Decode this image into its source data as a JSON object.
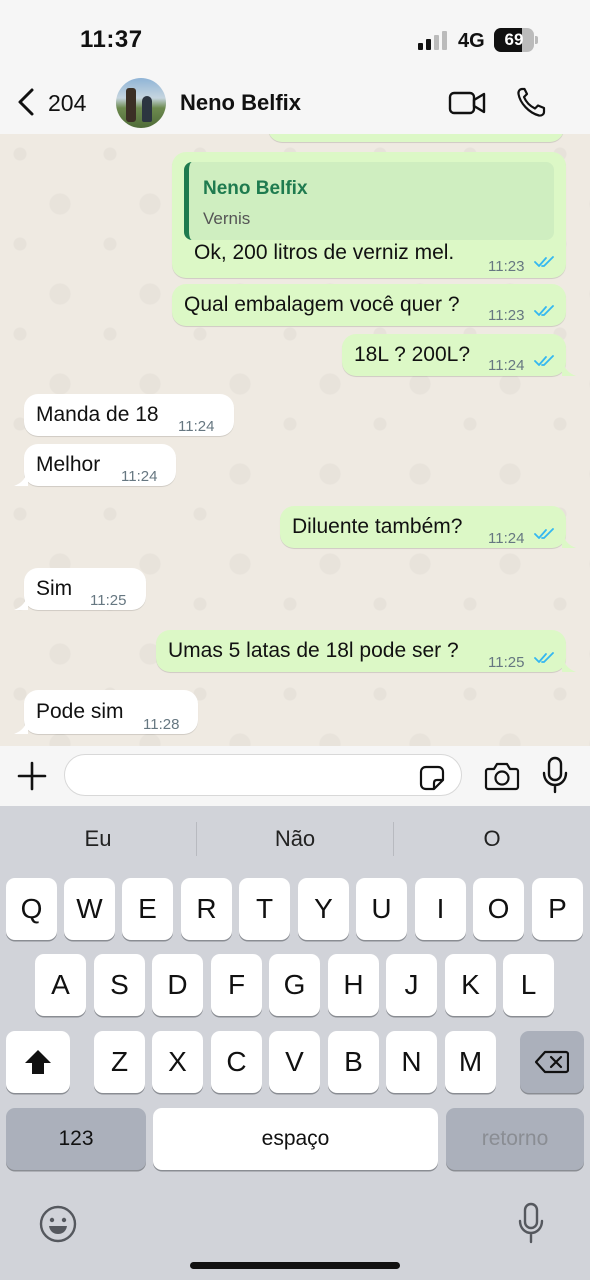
{
  "status_bar": {
    "time": "11:37",
    "network": "4G",
    "battery": "69",
    "battery_level": 0.69
  },
  "header": {
    "back_count": "204",
    "contact_name": "Neno Belfix"
  },
  "messages": [
    {
      "id": "m1",
      "direction": "out",
      "text": "Ok, 200 litros de verniz mel.",
      "time": "11:23",
      "reply_to": {
        "name": "Neno Belfix",
        "text": "Vernis"
      }
    },
    {
      "id": "m2",
      "direction": "out",
      "text": "Qual embalagem você quer ?",
      "time": "11:23"
    },
    {
      "id": "m3",
      "direction": "out",
      "text": "18L ? 200L?",
      "time": "11:24"
    },
    {
      "id": "m4",
      "direction": "in",
      "text": "Manda de 18",
      "time": "11:24"
    },
    {
      "id": "m5",
      "direction": "in",
      "text": "Melhor",
      "time": "11:24"
    },
    {
      "id": "m6",
      "direction": "out",
      "text": "Diluente também?",
      "time": "11:24"
    },
    {
      "id": "m7",
      "direction": "in",
      "text": "Sim",
      "time": "11:25"
    },
    {
      "id": "m8",
      "direction": "out",
      "text": "Umas 5 latas de 18l pode ser ?",
      "time": "11:25"
    },
    {
      "id": "m9",
      "direction": "in",
      "text": "Pode sim",
      "time": "11:28"
    }
  ],
  "input": {
    "placeholder": ""
  },
  "keyboard": {
    "suggestions": [
      "Eu",
      "Não",
      "O"
    ],
    "row1": [
      "Q",
      "W",
      "E",
      "R",
      "T",
      "Y",
      "U",
      "I",
      "O",
      "P"
    ],
    "row2": [
      "A",
      "S",
      "D",
      "F",
      "G",
      "H",
      "J",
      "K",
      "L"
    ],
    "row3": [
      "Z",
      "X",
      "C",
      "V",
      "B",
      "N",
      "M"
    ],
    "numbers_label": "123",
    "space_label": "espaço",
    "return_label": "retorno"
  },
  "colors": {
    "outgoing_bubble": "#dcf8c6",
    "incoming_bubble": "#ffffff",
    "read_ticks": "#34b7f1",
    "quote_accent": "#1f7b4f"
  }
}
